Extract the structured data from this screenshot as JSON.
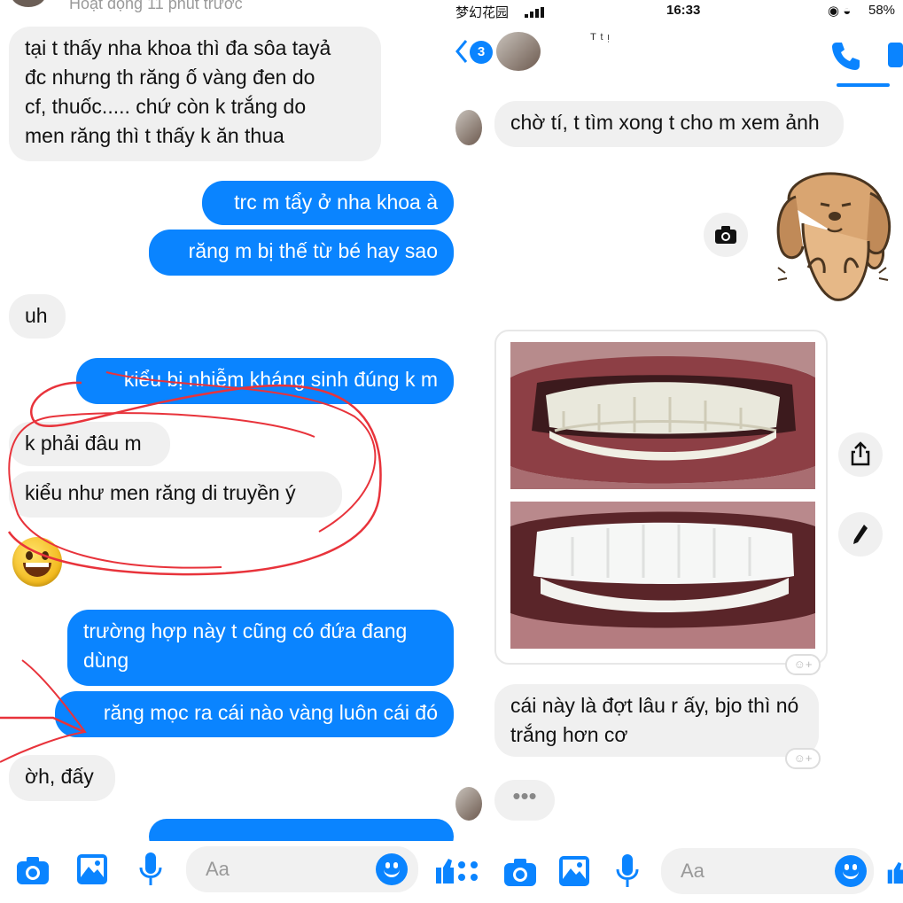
{
  "left": {
    "status_line": "Hoạt động 11 phút trước",
    "messages": [
      {
        "dir": "in",
        "text": "tại t thấy nha khoa thì đa sôa tayả\nđc nhưng th răng ố vàng đen do\ncf, thuốc..... chứ còn k trắng do\nmen răng thì t thấy k ăn thua"
      },
      {
        "dir": "out",
        "text": "trc m tẩy ở nha khoa à"
      },
      {
        "dir": "out",
        "text": "răng m bị thế từ bé hay sao"
      },
      {
        "dir": "in",
        "text": "uh"
      },
      {
        "dir": "out",
        "text": "kiểu bị nhiễm kháng sinh đúng k m"
      },
      {
        "dir": "in",
        "text": "k phải đâu m"
      },
      {
        "dir": "in",
        "text": "kiểu như men răng di truyền ý"
      },
      {
        "dir": "out",
        "text": "trường hợp này t cũng có đứa đang\ndùng"
      },
      {
        "dir": "out",
        "text": "răng mọc ra cái nào vàng luôn cái đó"
      },
      {
        "dir": "in",
        "text": "ờh, đấy"
      }
    ],
    "composer_placeholder": "Aa"
  },
  "right": {
    "status": {
      "carrier": "梦幻花园",
      "time": "16:33",
      "battery": "58%"
    },
    "unread_badge": "3",
    "contact_name": "ᵀ ᵗ ᵎ",
    "messages": [
      {
        "dir": "in",
        "text": "chờ tí, t tìm xong t cho m xem ảnh"
      },
      {
        "dir": "in",
        "text": "cái này là đợt lâu r ấy, bjo thì nó\ntrắng hơn cơ"
      }
    ],
    "typing_indicator": "•••",
    "react_label": "☺+",
    "composer_placeholder": "Aa"
  },
  "colors": {
    "accent": "#0a84ff",
    "incoming": "#f0f0f0",
    "scribble": "#e8333b"
  },
  "icons": [
    "camera-icon",
    "image-icon",
    "microphone-icon",
    "smiley-icon",
    "like-icon",
    "phone-icon",
    "share-icon",
    "edit-icon",
    "back-icon"
  ]
}
